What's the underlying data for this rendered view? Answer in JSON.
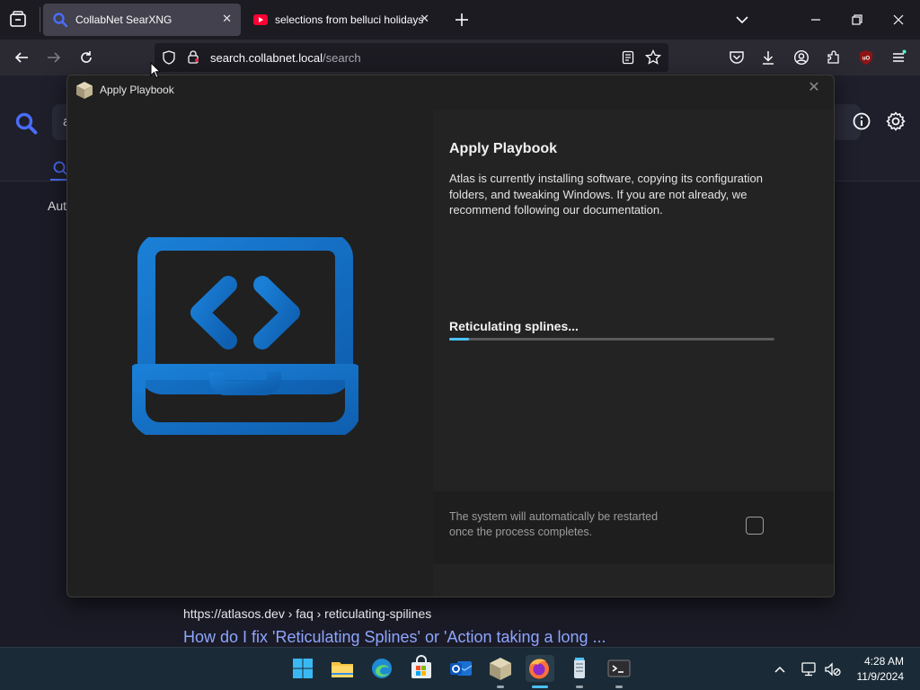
{
  "browser": {
    "tabs": [
      {
        "title": "CollabNet SearXNG",
        "active": true
      },
      {
        "title": "selections from belluci holidays",
        "active": false
      }
    ],
    "address": {
      "host": "search.collabnet.local",
      "path": "/search"
    },
    "colors": {
      "accent": "#4cc2ff",
      "search_icon": "#4a6cf7",
      "youtube": "#ff0033"
    }
  },
  "page": {
    "search_box_fragment": "a",
    "filter_fragment": "Aut"
  },
  "dialog": {
    "window_title": "Apply Playbook",
    "heading": "Apply Playbook",
    "description": "Atlas is currently installing software, copying its configuration folders, and tweaking Windows. If you are not already, we recommend following our documentation.",
    "status": "Reticulating splines...",
    "progress": 0.06,
    "footer_note": "The system will automatically be restarted once the process completes."
  },
  "result": {
    "url": "https://atlasos.dev  › faq › reticulating-spilines",
    "title": "How do I fix 'Reticulating Splines' or 'Action taking a long ..."
  },
  "taskbar": {
    "apps": [
      "start-icon",
      "file-explorer-icon",
      "edge-icon",
      "store-icon",
      "outlook-icon",
      "atlas-package-icon",
      "firefox-icon",
      "notepad-icon",
      "terminal-icon"
    ],
    "time": "4:28 AM",
    "date": "11/9/2024"
  }
}
